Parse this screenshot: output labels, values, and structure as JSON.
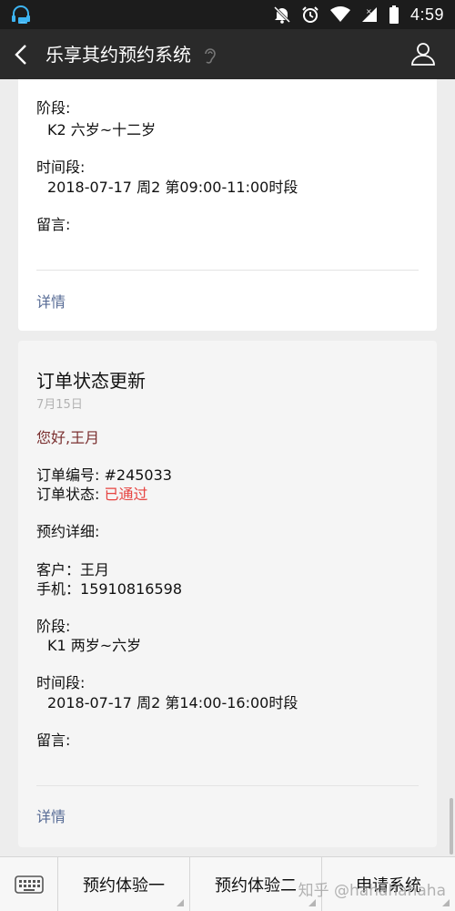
{
  "status_bar": {
    "time": "4:59",
    "icons": [
      "headset-notification-icon",
      "mute-icon",
      "alarm-icon",
      "wifi-icon",
      "signal-icon",
      "battery-icon"
    ]
  },
  "nav": {
    "title": "乐享其约预约系统",
    "back_icon": "chevron-left-icon",
    "ear_icon": "ear-icon",
    "profile_icon": "user-icon"
  },
  "card1": {
    "stage_label": "阶段:",
    "stage_value": "K2 六岁~十二岁",
    "time_label": "时间段:",
    "time_value": "2018-07-17 周2 第09:00-11:00时段",
    "message_label": "留言:",
    "detail_link": "详情"
  },
  "card2": {
    "heading": "订单状态更新",
    "date": "7月15日",
    "greeting": "您好,王月",
    "order_no_label": "订单编号: ",
    "order_no": "#245033",
    "order_status_label": "订单状态: ",
    "order_status": "已通过",
    "booking_detail_label": "预约详细:",
    "customer_label": "客户：",
    "customer_value": "王月",
    "phone_label": "手机：",
    "phone_value": "15910816598",
    "stage_label": "阶段:",
    "stage_value": "K1 两岁~六岁",
    "time_label": "时间段:",
    "time_value": "2018-07-17 周2 第14:00-16:00时段",
    "message_label": "留言:",
    "detail_link": "详情"
  },
  "bottom_menu": {
    "keyboard_icon": "keyboard-icon",
    "items": [
      "预约体验一",
      "预约体验二",
      "申请系统"
    ]
  },
  "watermark": "知乎 @hahahahaha",
  "colors": {
    "status_red": "#e64340",
    "link_blue": "#576b95",
    "greeting": "#7a2f2f",
    "navbar": "#2a2a2a"
  }
}
